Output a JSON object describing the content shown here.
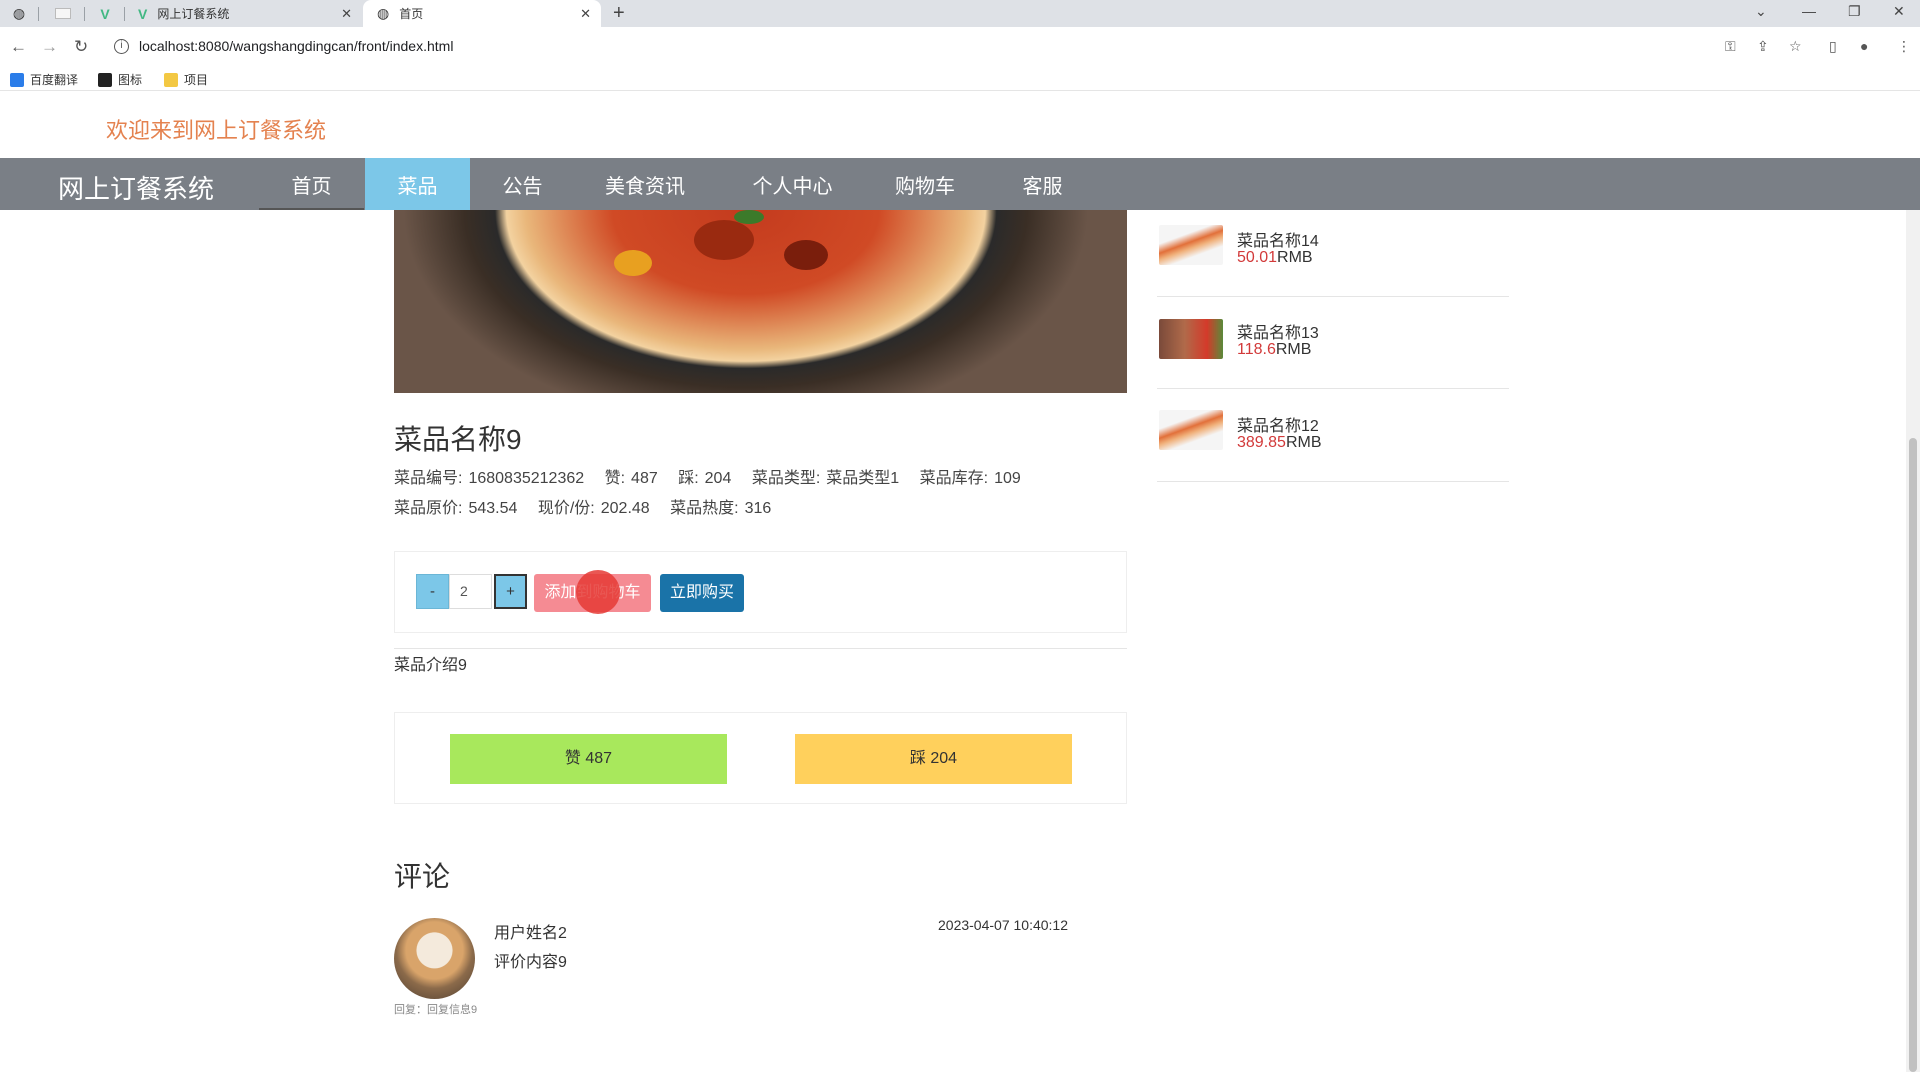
{
  "browser": {
    "tabs": [
      {
        "title": "网上订餐系统"
      },
      {
        "title": "首页"
      }
    ],
    "url": "localhost:8080/wangshangdingcan/front/index.html",
    "bookmarks": [
      "百度翻译",
      "图标",
      "项目"
    ]
  },
  "site": {
    "welcome": "欢迎来到网上订餐系统",
    "brand": "网上订餐系统",
    "nav": [
      "首页",
      "菜品",
      "公告",
      "美食资讯",
      "个人中心",
      "购物车",
      "客服"
    ],
    "active_nav": "菜品"
  },
  "dish": {
    "name": "菜品名称9",
    "row1": [
      {
        "label": "菜品编号:",
        "value": "1680835212362"
      },
      {
        "label": "赞:",
        "value": "487"
      },
      {
        "label": "踩:",
        "value": "204"
      },
      {
        "label": "菜品类型:",
        "value": "菜品类型1"
      },
      {
        "label": "菜品库存:",
        "value": "109"
      }
    ],
    "row2": [
      {
        "label": "菜品原价:",
        "value": "543.54"
      },
      {
        "label": "现价/份:",
        "value": "202.48"
      },
      {
        "label": "菜品热度:",
        "value": "316"
      }
    ],
    "quantity": "2",
    "minus_label": "-",
    "plus_label": "+",
    "add_cart_label": "添加到购物车",
    "buy_now_label": "立即购买",
    "intro": "菜品介绍9",
    "like_label": "赞  487",
    "dislike_label": "踩  204"
  },
  "comments": {
    "title": "评论",
    "items": [
      {
        "user": "用户姓名2",
        "content": "评价内容9",
        "time": "2023-04-07 10:40:12",
        "reply": "回复：回复信息9"
      }
    ]
  },
  "sidebar": {
    "items": [
      {
        "name": "菜品名称14",
        "price": "50.01",
        "unit": "RMB"
      },
      {
        "name": "菜品名称13",
        "price": "118.6",
        "unit": "RMB"
      },
      {
        "name": "菜品名称12",
        "price": "389.85",
        "unit": "RMB"
      }
    ]
  },
  "colors": {
    "nav_bg": "#7a7f86",
    "nav_active": "#7cc7e8",
    "welcome": "#e4824f",
    "price": "#d23a3a",
    "like": "#a8e85c",
    "dislike": "#ffd05c",
    "buy": "#1a73a8",
    "add_cart": "#f58b93"
  }
}
